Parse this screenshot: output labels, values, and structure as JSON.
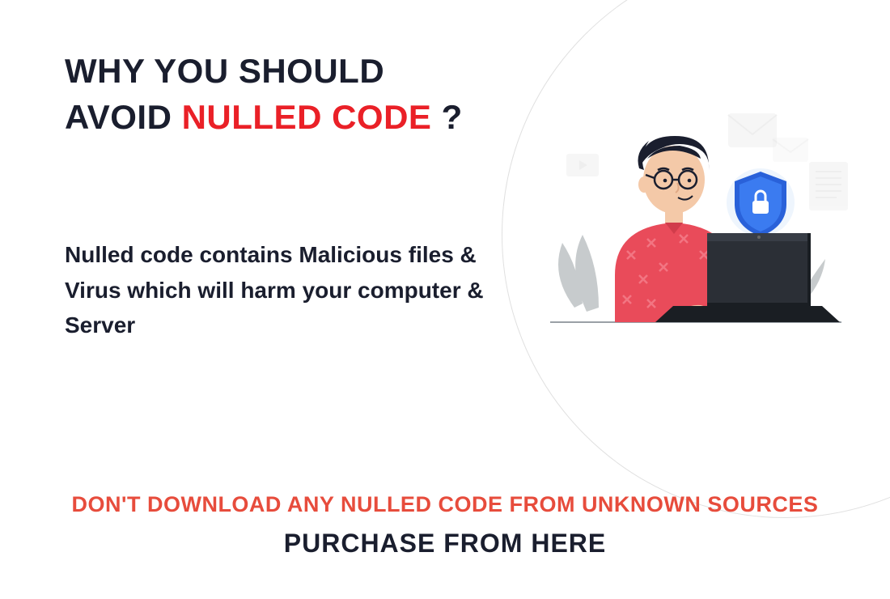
{
  "headline": {
    "line1": "WHY YOU SHOULD",
    "line2_pre": "AVOID ",
    "line2_highlight": "NULLED CODE",
    "line2_post": " ?"
  },
  "body": "Nulled code contains Malicious files & Virus which will harm your computer & Server",
  "warning": "DON'T DOWNLOAD ANY NULLED CODE FROM UNKNOWN SOURCES",
  "cta": "PURCHASE FROM HERE",
  "colors": {
    "accent_red": "#ea2027",
    "warning_orange": "#e74c3c",
    "dark": "#1a1e2e"
  },
  "icons": {
    "shield": "shield-lock-icon",
    "envelope": "envelope-icon",
    "document": "document-icon",
    "play": "play-icon"
  }
}
